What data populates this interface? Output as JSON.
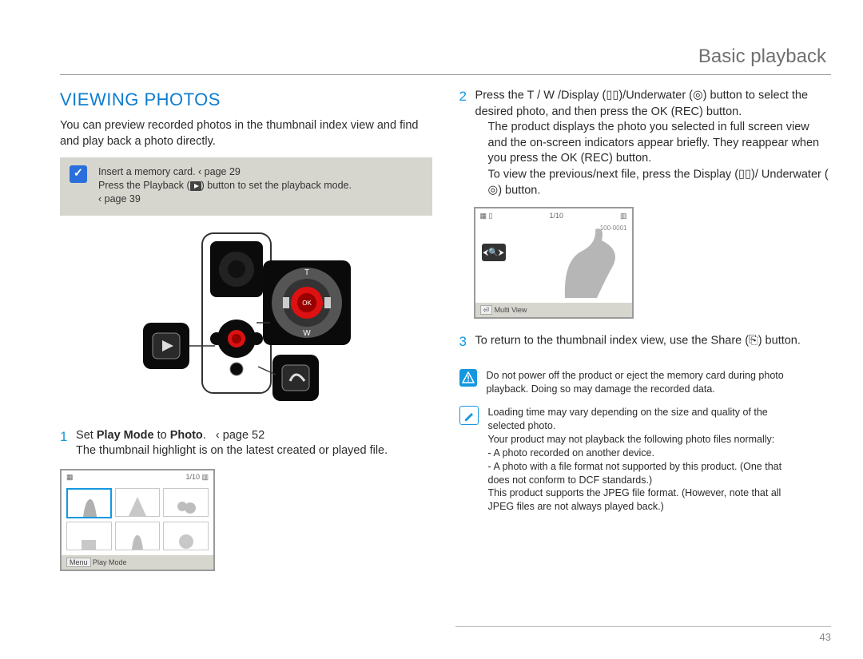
{
  "header": {
    "breadcrumb": "Basic playback"
  },
  "section": {
    "title": "VIEWING PHOTOS"
  },
  "intro": "You can preview recorded photos in the thumbnail index view and find and play back a photo directly.",
  "precheck": {
    "line1a": "Insert a memory card. ",
    "line1b": "‹ page 29",
    "line2a": "Press the Playback (",
    "line2b": ") button to set the playback mode.",
    "line3": "‹ page 39"
  },
  "step1": {
    "num": "1",
    "line1a": "Set ",
    "line1b": "Play Mode",
    "line1c": " to ",
    "line1d": "Photo",
    "line1e": ". ",
    "line1f": "‹ page 52",
    "line2": "The thumbnail highlight is on the latest created or played file."
  },
  "thumb_view": {
    "counter": "1/10",
    "footer_label": "Play Mode",
    "footer_btn": "Menu"
  },
  "step2": {
    "num": "2",
    "p1a": "Press the T / W /Display (",
    "p1b": ")/Underwater (",
    "p1c": ") button to select the desired photo, and then press the OK (REC) button.",
    "p2": "The product displays the photo you selected in full screen view and the on-screen indicators appear briefly. They reappear when you press the OK (REC) button.",
    "p3a": "To view the previous/next file, press the Display (",
    "p3b": ")/ Underwater (",
    "p3c": ") button."
  },
  "full_view": {
    "counter": "1/10",
    "fileno": "100-0001",
    "zoom_icon": "⤢",
    "footer_label": "Multi View",
    "footer_btn": "⏎"
  },
  "step3": {
    "num": "3",
    "texta": "To return to the thumbnail index view, use the Share (",
    "textb": ") button."
  },
  "warning": {
    "line1": "Do not power off the product or eject the memory card during photo",
    "line2": "playback. Doing so may damage the recorded data."
  },
  "note": {
    "l1": "Loading time may vary depending on the size and quality of the",
    "l2": "selected photo.",
    "l3": "Your product may not playback the following photo files normally:",
    "l4": "- A photo recorded on another device.",
    "l5": "- A photo with a file format not supported by this product. (One that",
    "l6": "  does not conform to DCF standards.)",
    "l7": "This product supports the JPEG file format. (However, note that all",
    "l8": "JPEG files are not always played back.)"
  },
  "icons": {
    "display": "▯▯",
    "underwater": "◎",
    "share": "⎘",
    "play": "▸",
    "check": "✓",
    "warn": "△",
    "note": "✎"
  },
  "pagenum": "43"
}
